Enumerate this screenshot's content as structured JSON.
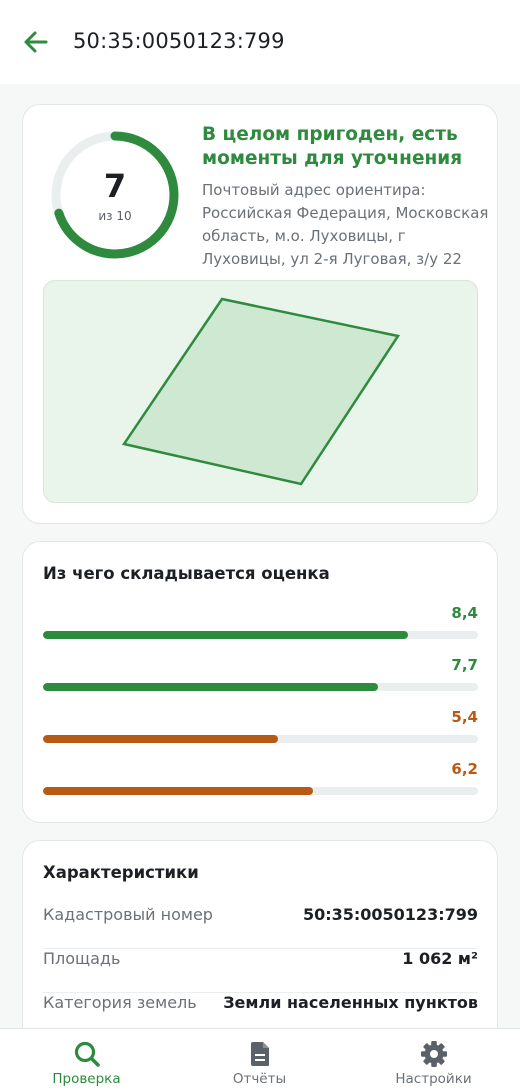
{
  "header": {
    "title": "50:35:0050123:799",
    "back_icon": "arrow-left-icon"
  },
  "score_card": {
    "score": "7",
    "score_out_of": "из 10",
    "score_fraction": 0.7,
    "verdict": "В целом пригоден, есть моменты для уточнения",
    "address": "Почтовый адрес ориентира: Российская Федерация, Московская область, м.о. Луховицы, г Луховицы, ул 2-я Луговая, з/у 22",
    "accent_color": "#2e8b3e"
  },
  "breakdown": {
    "title": "Из чего складывается оценка",
    "items": [
      {
        "value": "8,4",
        "level": 0.84,
        "color": "#2e8b3e"
      },
      {
        "value": "7,7",
        "level": 0.77,
        "color": "#2e8b3e"
      },
      {
        "value": "5,4",
        "level": 0.54,
        "color": "#b85a14"
      },
      {
        "value": "6,2",
        "level": 0.62,
        "color": "#b85a14"
      }
    ]
  },
  "specs": {
    "title": "Характеристики",
    "rows": [
      {
        "label": "Кадастровый номер",
        "value": "50:35:0050123:799"
      },
      {
        "label": "Площадь",
        "value": "1 062 м²"
      },
      {
        "label": "Категория земель",
        "value": "Земли населенных пунктов"
      }
    ]
  },
  "nav": {
    "items": [
      {
        "label": "Проверка",
        "icon": "search-icon",
        "active": true
      },
      {
        "label": "Отчёты",
        "icon": "document-icon",
        "active": false
      },
      {
        "label": "Настройки",
        "icon": "gear-icon",
        "active": false
      }
    ]
  }
}
